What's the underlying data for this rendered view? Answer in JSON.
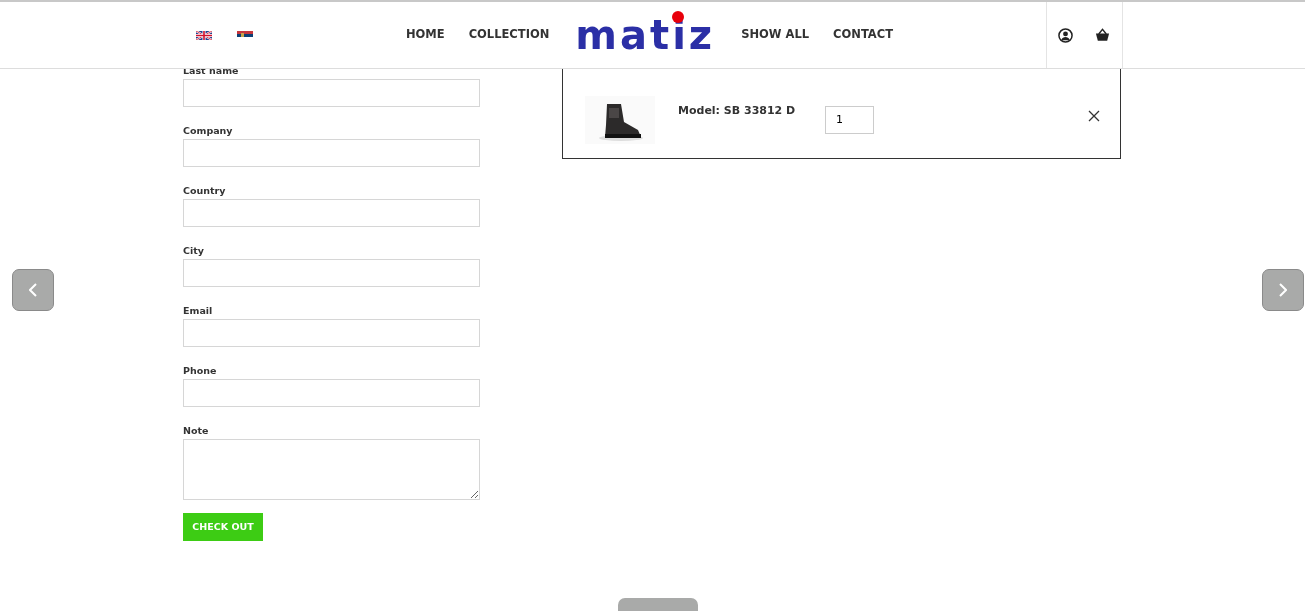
{
  "nav": {
    "left": [
      "HOME",
      "COLLECTION"
    ],
    "logo": "matiz",
    "right": [
      "SHOW ALL",
      "CONTACT"
    ]
  },
  "form": {
    "fields": [
      {
        "label": "Last name",
        "kind": "input"
      },
      {
        "label": "Company",
        "kind": "input"
      },
      {
        "label": "Country",
        "kind": "input"
      },
      {
        "label": "City",
        "kind": "input"
      },
      {
        "label": "Email",
        "kind": "input"
      },
      {
        "label": "Phone",
        "kind": "input"
      },
      {
        "label": "Note",
        "kind": "textarea"
      }
    ],
    "submit": "CHECK OUT"
  },
  "cart": {
    "items": [
      {
        "model": "Model: SB 33812 D",
        "quantity": "1"
      }
    ]
  }
}
